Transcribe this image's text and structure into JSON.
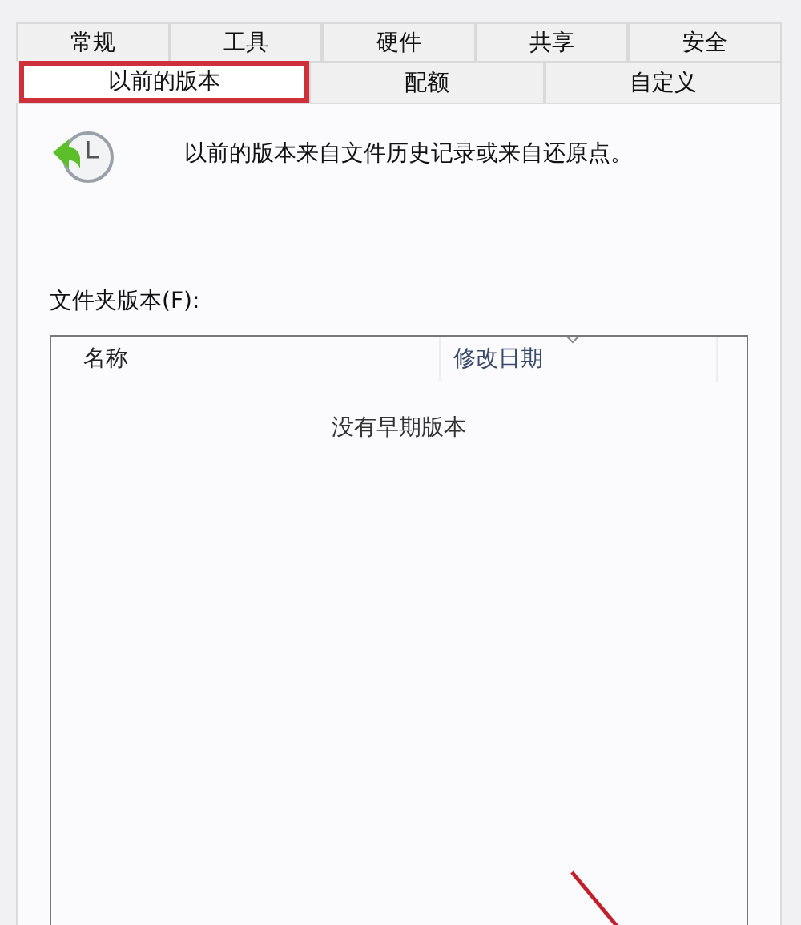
{
  "tab_rows": [
    {
      "tabs": [
        {
          "label": "常规",
          "selected": false,
          "highlighted": false
        },
        {
          "label": "工具",
          "selected": false,
          "highlighted": false
        },
        {
          "label": "硬件",
          "selected": false,
          "highlighted": false
        },
        {
          "label": "共享",
          "selected": false,
          "highlighted": false
        },
        {
          "label": "安全",
          "selected": false,
          "highlighted": false
        }
      ]
    },
    {
      "tabs": [
        {
          "label": "以前的版本",
          "selected": true,
          "highlighted": true
        },
        {
          "label": "配额",
          "selected": false,
          "highlighted": false
        },
        {
          "label": "自定义",
          "selected": false,
          "highlighted": false
        }
      ]
    }
  ],
  "intro": {
    "text": "以前的版本来自文件历史记录或来自还原点。"
  },
  "versions": {
    "label": "文件夹版本(F):",
    "columns": [
      {
        "label": "名称",
        "sorted": false
      },
      {
        "label": "修改日期",
        "sorted": true
      }
    ],
    "empty_message": "没有早期版本"
  }
}
